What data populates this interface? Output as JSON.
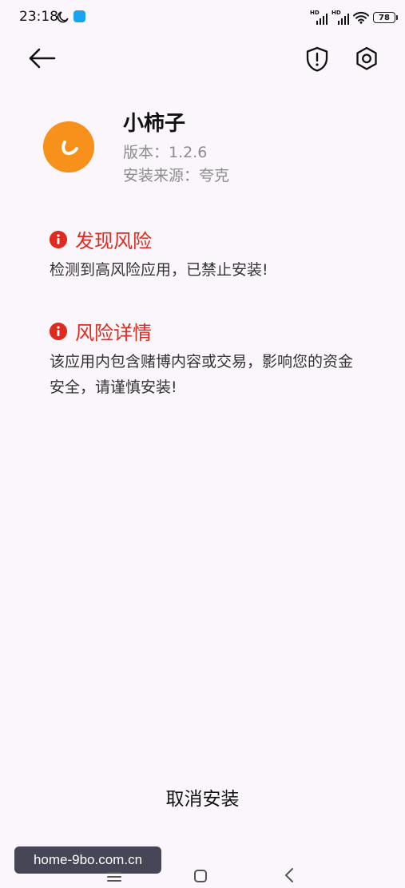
{
  "status_bar": {
    "time": "23:18",
    "battery": "78",
    "network_1": "HD",
    "network_2": "HD"
  },
  "toolbar": {
    "back_icon": "arrow-left-icon",
    "security_icon": "shield-alert-icon",
    "settings_icon": "gear-icon"
  },
  "app": {
    "name": "小柿子",
    "version": "版本：1.2.6",
    "source": "安装来源：夸克",
    "icon_color": "#f7911c"
  },
  "risk_found": {
    "title": "发现风险",
    "body": "检测到高风险应用，已禁止安装!"
  },
  "risk_details": {
    "title": "风险详情",
    "body": "该应用内包含赌博内容或交易，影响您的资金安全，请谨慎安装!"
  },
  "actions": {
    "cancel_install": "取消安装"
  },
  "watermark": {
    "text": "home-9bo.com.cn"
  },
  "colors": {
    "danger": "#e02a1e",
    "background": "#fbf6fb",
    "secondary_text": "#8c8c8c"
  }
}
